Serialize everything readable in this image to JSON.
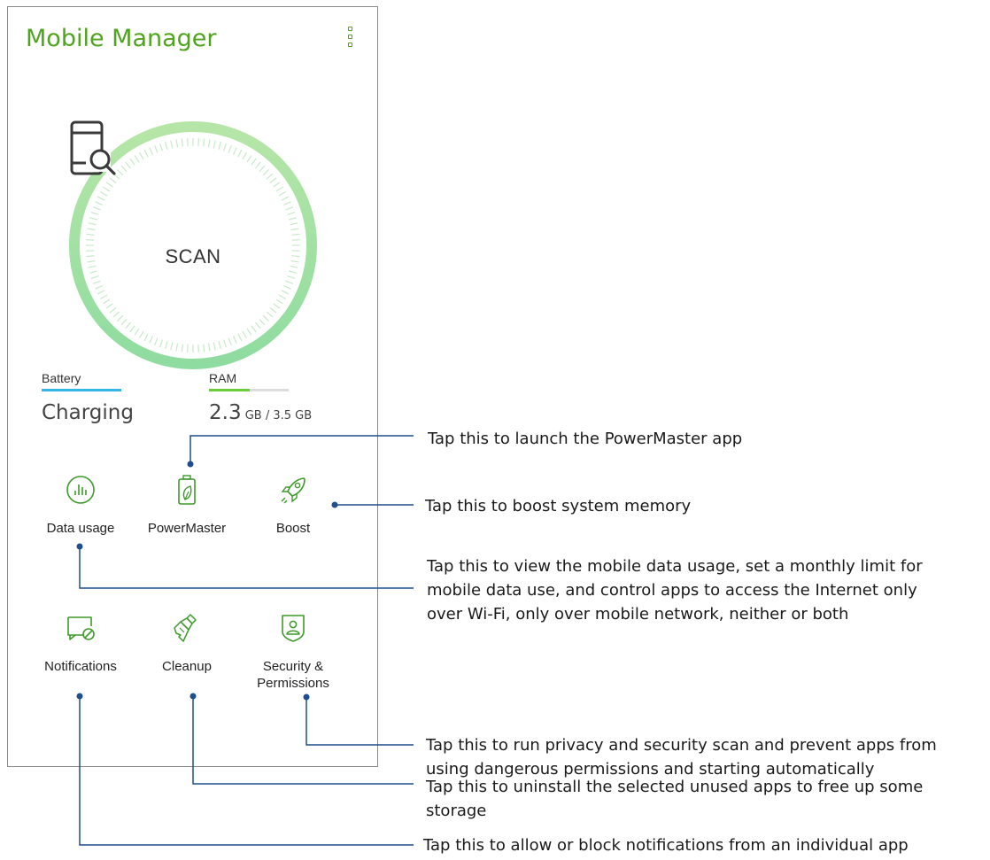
{
  "app": {
    "title": "Mobile Manager"
  },
  "scan": {
    "label": "SCAN"
  },
  "stats": {
    "battery": {
      "label": "Battery",
      "value": "Charging",
      "accent": "#33b5e5"
    },
    "ram": {
      "label": "RAM",
      "value": "2.3",
      "unit": " GB / 3.5 GB",
      "used_fraction": 0.51,
      "accent": "#6ccb3b"
    }
  },
  "tiles": [
    {
      "label": "Data usage",
      "icon": "bar-chart-circle-icon"
    },
    {
      "label": "PowerMaster",
      "icon": "battery-leaf-icon"
    },
    {
      "label": "Boost",
      "icon": "rocket-icon"
    },
    {
      "label": "Notifications",
      "icon": "message-block-icon"
    },
    {
      "label": "Cleanup",
      "icon": "broom-icon"
    },
    {
      "label_line1": "Security &",
      "label_line2": "Permissions",
      "icon": "shield-user-icon"
    }
  ],
  "callouts": {
    "powermaster": "Tap this to launch the PowerMaster app",
    "boost": "Tap this to boost system memory",
    "data_usage_1": "Tap this to view the mobile data usage, set a monthly limit for",
    "data_usage_2": "mobile data use, and control apps to access the Internet only",
    "data_usage_3": "over Wi-Fi, only over mobile network, neither or both",
    "security_1": "Tap this to run privacy and security scan and prevent apps from",
    "security_2": "using dangerous permissions and starting automatically",
    "cleanup_1": "Tap this to uninstall the selected unused apps to free up some",
    "cleanup_2": "storage",
    "notifications": "Tap this to allow or block notifications from an individual app"
  },
  "colors": {
    "brand_green": "#4fa41e",
    "icon_green": "#3e9a2a",
    "callout_line": "#1f4e8c"
  }
}
